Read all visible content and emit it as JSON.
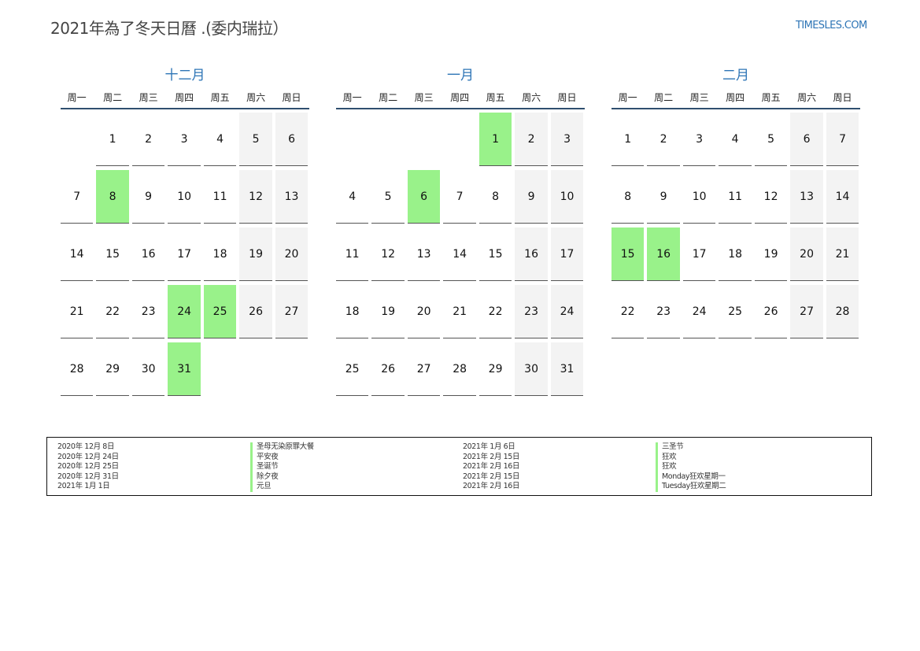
{
  "header": {
    "title": "2021年為了冬天日曆 .(委内瑞拉）",
    "site": "TIMESLES.COM"
  },
  "weekdays": [
    "周一",
    "周二",
    "周三",
    "周四",
    "周五",
    "周六",
    "周日"
  ],
  "colors": {
    "accent": "#2e75b6",
    "holiday": "#99f28a",
    "weekend": "#f3f3f3"
  },
  "months": [
    {
      "name": "十二月",
      "offset": 1,
      "days": 31,
      "holidays": [
        8,
        24,
        25,
        31
      ]
    },
    {
      "name": "一月",
      "offset": 4,
      "days": 31,
      "holidays": [
        1,
        6
      ]
    },
    {
      "name": "二月",
      "offset": 0,
      "days": 28,
      "holidays": [
        15,
        16
      ]
    }
  ],
  "legend": [
    {
      "date": "2020年 12月 8日",
      "name": "圣母无染原罪大餐"
    },
    {
      "date": "2020年 12月 24日",
      "name": "平安夜"
    },
    {
      "date": "2020年 12月 25日",
      "name": "圣诞节"
    },
    {
      "date": "2020年 12月 31日",
      "name": "除夕夜"
    },
    {
      "date": "2021年 1月 1日",
      "name": "元旦"
    },
    {
      "date": "2021年 1月 6日",
      "name": "三圣节"
    },
    {
      "date": "2021年 2月 15日",
      "name": "狂欢"
    },
    {
      "date": "2021年 2月 16日",
      "name": "狂欢"
    },
    {
      "date": "2021年 2月 15日",
      "name": "Monday狂欢星期一"
    },
    {
      "date": "2021年 2月 16日",
      "name": "Tuesday狂欢星期二"
    }
  ]
}
